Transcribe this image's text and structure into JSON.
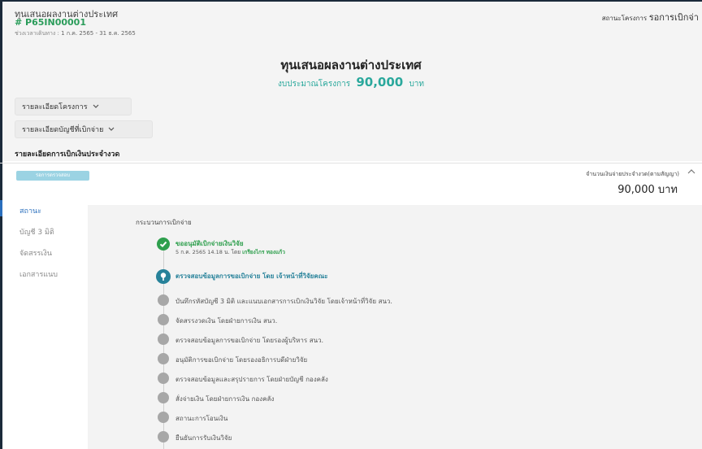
{
  "header": {
    "project_type": "ทุนเสนอผลงานต่างประเทศ",
    "project_code": "# P65IN00001",
    "period_label": "ช่วงเวลาเดินทาง :",
    "period_value": "1 ก.ค. 2565 - 31 ธ.ค. 2565",
    "status_label": "สถานะโครงการ",
    "status_value": "รอการเบิกจ่า"
  },
  "main": {
    "title": "ทุนเสนอผลงานต่างประเทศ",
    "budget_label": "งบประมาณโครงการ",
    "budget_amount": "90,000",
    "budget_unit": "บาท"
  },
  "accordions": [
    {
      "label": "รายละเอียดโครงการ"
    },
    {
      "label": "รายละเอียดบัญชีที่เบิกจ่าย"
    }
  ],
  "section": {
    "label": "รายละเอียดการเบิกเงินประจำงวด",
    "badge": "รอการตรวจสอบ",
    "amount_label": "จำนวนเงินจ่ายประจำงวด(ตามสัญญา)",
    "amount_value": "90,000 บาท"
  },
  "tabs": [
    {
      "label": "สถานะ",
      "active": true
    },
    {
      "label": "บัญชี 3 มิติ",
      "active": false
    },
    {
      "label": "จัดสรรเงิน",
      "active": false
    },
    {
      "label": "เอกสารแนบ",
      "active": false
    }
  ],
  "process": {
    "title": "กระบวนการเบิกจ่าย",
    "steps": [
      {
        "label": "ขออนุมัติเบิกจ่ายเงินวิจัย",
        "status": "done",
        "sub_prefix": "5 ก.ค. 2565 14.18 น. โดย",
        "sub_who": "เกรียงไกร ทองแก้ว"
      },
      {
        "label": "ตรวจสอบข้อมูลการขอเบิกจ่าย โดย เจ้าหน้าที่วิจัยคณะ",
        "status": "current"
      },
      {
        "label": "บันทึกรหัสบัญชี 3 มิติ และแนบเอกสารการเบิกเงินวิจัย โดยเจ้าหน้าที่วิจัย สนว.",
        "status": "pending"
      },
      {
        "label": "จัดสรรงวดเงิน โดยฝ่ายการเงิน สนว.",
        "status": "pending"
      },
      {
        "label": "ตรวจสอบข้อมูลการขอเบิกจ่าย โดยรองผู้บริหาร สนว.",
        "status": "pending"
      },
      {
        "label": "อนุมัติการขอเบิกจ่าย โดยรองอธิการบดีฝ่ายวิจัย",
        "status": "pending"
      },
      {
        "label": "ตรวจสอบข้อมูลและสรุปรายการ โดยฝ่ายบัญชี กองคลัง",
        "status": "pending"
      },
      {
        "label": "สั่งจ่ายเงิน โดยฝ่ายการเงิน กองคลัง",
        "status": "pending"
      },
      {
        "label": "สถานะการโอนเงิน",
        "status": "pending"
      },
      {
        "label": "ยืนยันการรับเงินวิจัย",
        "status": "pending"
      }
    ]
  },
  "colors": {
    "accent_green": "#2e9f4d",
    "accent_teal": "#27829a",
    "tab_active": "#2a6fbd",
    "badge_bg": "#9bd3e3"
  }
}
